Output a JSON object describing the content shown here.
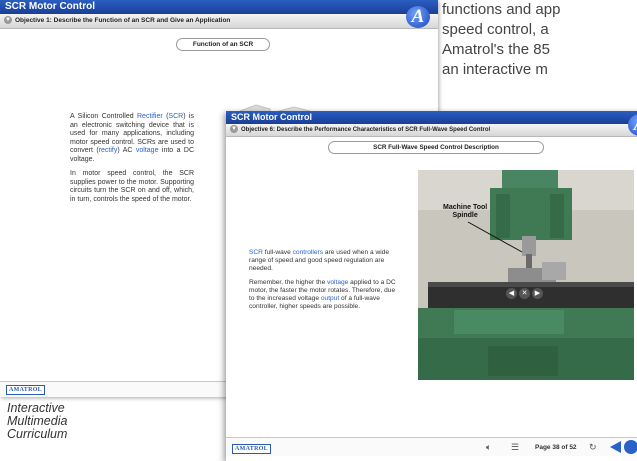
{
  "ad_text": {
    "lines": [
      "functions and app",
      "speed control, a",
      "Amatrol's the 85",
      "an interactive m"
    ]
  },
  "caption": {
    "lines": [
      "Interactive",
      "Multimedia",
      "Curriculum"
    ]
  },
  "back_window": {
    "title": "SCR Motor Control",
    "objective": "Objective 1: Describe the Function of an SCR and Give an Application",
    "logo_letter": "A",
    "section_title": "Function of an SCR",
    "para1": {
      "t1": "A Silicon Controlled ",
      "link1": "Rectifier",
      "t2": " (",
      "link2": "SCR",
      "t3": ") is an electronic switching device that is used for many applications, including motor speed control. SCRs are used to convert (",
      "link3": "rectify",
      "t4": ") AC ",
      "link4": "voltage",
      "t5": " into a DC voltage."
    },
    "para2": "In motor speed control, the SCR supplies power to the motor. Supporting circuits turn the SCR on and off, which, in turn, controls the speed of the motor.",
    "brand": "AMATROL"
  },
  "front_window": {
    "title": "SCR Motor Control",
    "objective": "Objective 6: Describe the Performance Characteristics of SCR Full-Wave Speed Control",
    "logo_letter": "A",
    "section_title": "SCR Full-Wave Speed Control Description",
    "para1": {
      "link1": "SCR",
      "t1": " full-wave ",
      "link2": "controllers",
      "t2": " are used when a wide range of speed and good speed regulation are needed."
    },
    "para2": {
      "t1": "Remember, the higher the ",
      "link1": "voltage",
      "t2": " applied to a DC motor, the faster the motor rotates. Therefore, due to the increased voltage ",
      "link2": "output",
      "t3": " of a full-wave controller, higher speeds are possible."
    },
    "photo_label_line1": "Machine Tool",
    "photo_label_line2": "Spindle",
    "brand": "AMATROL",
    "page_indicator": "Page 38 of 52"
  },
  "colors": {
    "title_bar": "#1f4aa8",
    "link": "#2a62c9",
    "machine_green": "#3f7a55"
  },
  "icons": [
    "chevron-down-icon",
    "amatrol-a-logo",
    "mute-icon",
    "menu-icon",
    "refresh-icon",
    "previous-page-icon",
    "next-page-icon"
  ]
}
